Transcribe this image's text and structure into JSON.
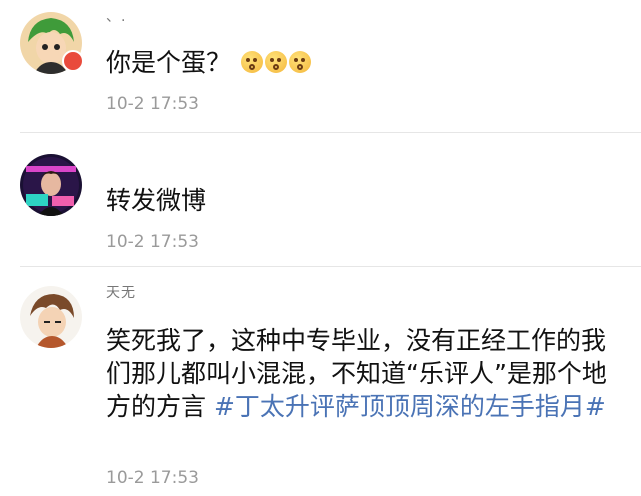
{
  "comments": [
    {
      "username": "、.",
      "text": "你是个蛋？",
      "emojis": [
        "surprised-face",
        "surprised-face",
        "surprised-face"
      ],
      "timestamp": "10-2 17:53"
    },
    {
      "username": "",
      "text": "转发微博",
      "timestamp": "10-2 17:53"
    },
    {
      "username": "天无",
      "text": "笑死我了，这种中专毕业，没有正经工作的我们那儿都叫小混混，不知道“乐评人”是那个地方的方言",
      "hashtag": "#丁太升评萨顶顶周深的左手指月#",
      "timestamp": "10-2 17:53"
    }
  ],
  "colors": {
    "hashtag": "#4a73b5",
    "timestamp": "#9a9a9a",
    "text": "#111111",
    "badge": "#e94b3c"
  }
}
